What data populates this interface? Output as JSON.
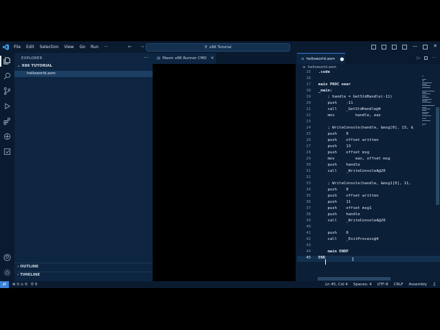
{
  "window": {
    "title": "x86 Tutorial"
  },
  "menu": [
    "File",
    "Edit",
    "Selection",
    "View",
    "Go",
    "Run",
    "···"
  ],
  "sidebar": {
    "header": "EXPLORER",
    "folder": "X86 TUTORIAL",
    "files": [
      "helloworld.asm"
    ],
    "outline": "OUTLINE",
    "timeline": "TIMELINE"
  },
  "runner": {
    "tab_label": "Masm x86 Runner CMD"
  },
  "editor": {
    "tab_label": "helloworld.asm",
    "breadcrumb": "helloworld.asm",
    "lines": [
      {
        "n": "15",
        "code": ".code"
      },
      {
        "n": "16",
        "code": ""
      },
      {
        "n": "17",
        "code": "main PROC near"
      },
      {
        "n": "18",
        "code": "_main:"
      },
      {
        "n": "19",
        "code": "    ; handle = GetStdHandle(-11)"
      },
      {
        "n": "20",
        "code": "    push    -11"
      },
      {
        "n": "21",
        "code": "    call    _GetStdHandle@4"
      },
      {
        "n": "22",
        "code": "    mov         handle, eax"
      },
      {
        "n": "23",
        "code": ""
      },
      {
        "n": "24",
        "code": "    ; WriteConsole(handle, &msg[0], 13, &"
      },
      {
        "n": "25",
        "code": "    push    0"
      },
      {
        "n": "26",
        "code": "    push    offset written"
      },
      {
        "n": "27",
        "code": "    push    13"
      },
      {
        "n": "28",
        "code": "    push    offset msg"
      },
      {
        "n": "29",
        "code": "    mov         eax, offset msg"
      },
      {
        "n": "30",
        "code": "    push    handle"
      },
      {
        "n": "31",
        "code": "    call    _WriteConsoleA@20"
      },
      {
        "n": "32",
        "code": ""
      },
      {
        "n": "33",
        "code": "    ; WriteConsole(handle, &msg1[0], 11,"
      },
      {
        "n": "34",
        "code": "    push    0"
      },
      {
        "n": "35",
        "code": "    push    offset written"
      },
      {
        "n": "36",
        "code": "    push    11"
      },
      {
        "n": "37",
        "code": "    push    offset msg1"
      },
      {
        "n": "38",
        "code": "    push    handle"
      },
      {
        "n": "39",
        "code": "    call    _WriteConsoleA@20"
      },
      {
        "n": "40",
        "code": ""
      },
      {
        "n": "41",
        "code": "    push    0"
      },
      {
        "n": "42",
        "code": "    call    _ExitProcess@4"
      },
      {
        "n": "43",
        "code": ""
      },
      {
        "n": "44",
        "code": "    main ENDP"
      },
      {
        "n": "45",
        "code": "END"
      }
    ]
  },
  "status": {
    "remote": "⇄",
    "errors": "⊗ 0 ⚠ 0",
    "ports": "⚲ 0",
    "position": "Ln 45, Col 4",
    "spaces": "Spaces: 4",
    "encoding": "UTF-8",
    "eol": "CRLF",
    "language": "Assembly"
  },
  "colors": {
    "accent": "#3b82d6",
    "background": "#0b1f37"
  }
}
